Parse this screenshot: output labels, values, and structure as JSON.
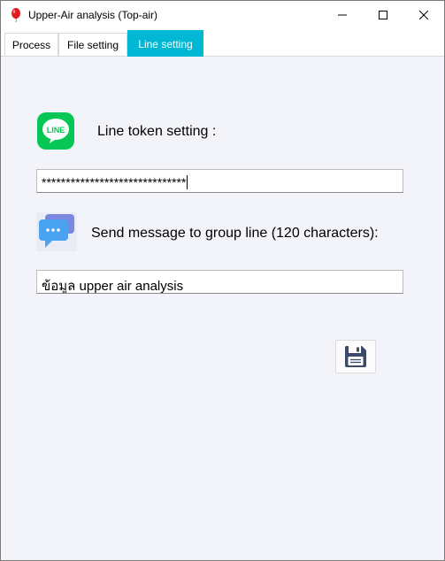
{
  "window": {
    "title": "Upper-Air analysis (Top-air)",
    "icon": "balloon-icon",
    "controls": [
      "minimize-icon",
      "maximize-icon",
      "close-icon"
    ]
  },
  "tabs": [
    {
      "label": "Process",
      "active": false
    },
    {
      "label": "File setting",
      "active": false
    },
    {
      "label": "Line setting",
      "active": true
    }
  ],
  "line_setting": {
    "line_icon_text": "LINE",
    "token_label": "Line token setting :",
    "token_value": "******************************",
    "message_label": "Send message to group line (120 characters):",
    "message_value": "ข้อมูล upper air analysis",
    "save_icon": "floppy-disk-icon"
  },
  "colors": {
    "active_tab": "#00b7d4",
    "line_green": "#06c755",
    "chat_blue": "#4aa3f0",
    "save_icon": "#3b4a6b"
  }
}
